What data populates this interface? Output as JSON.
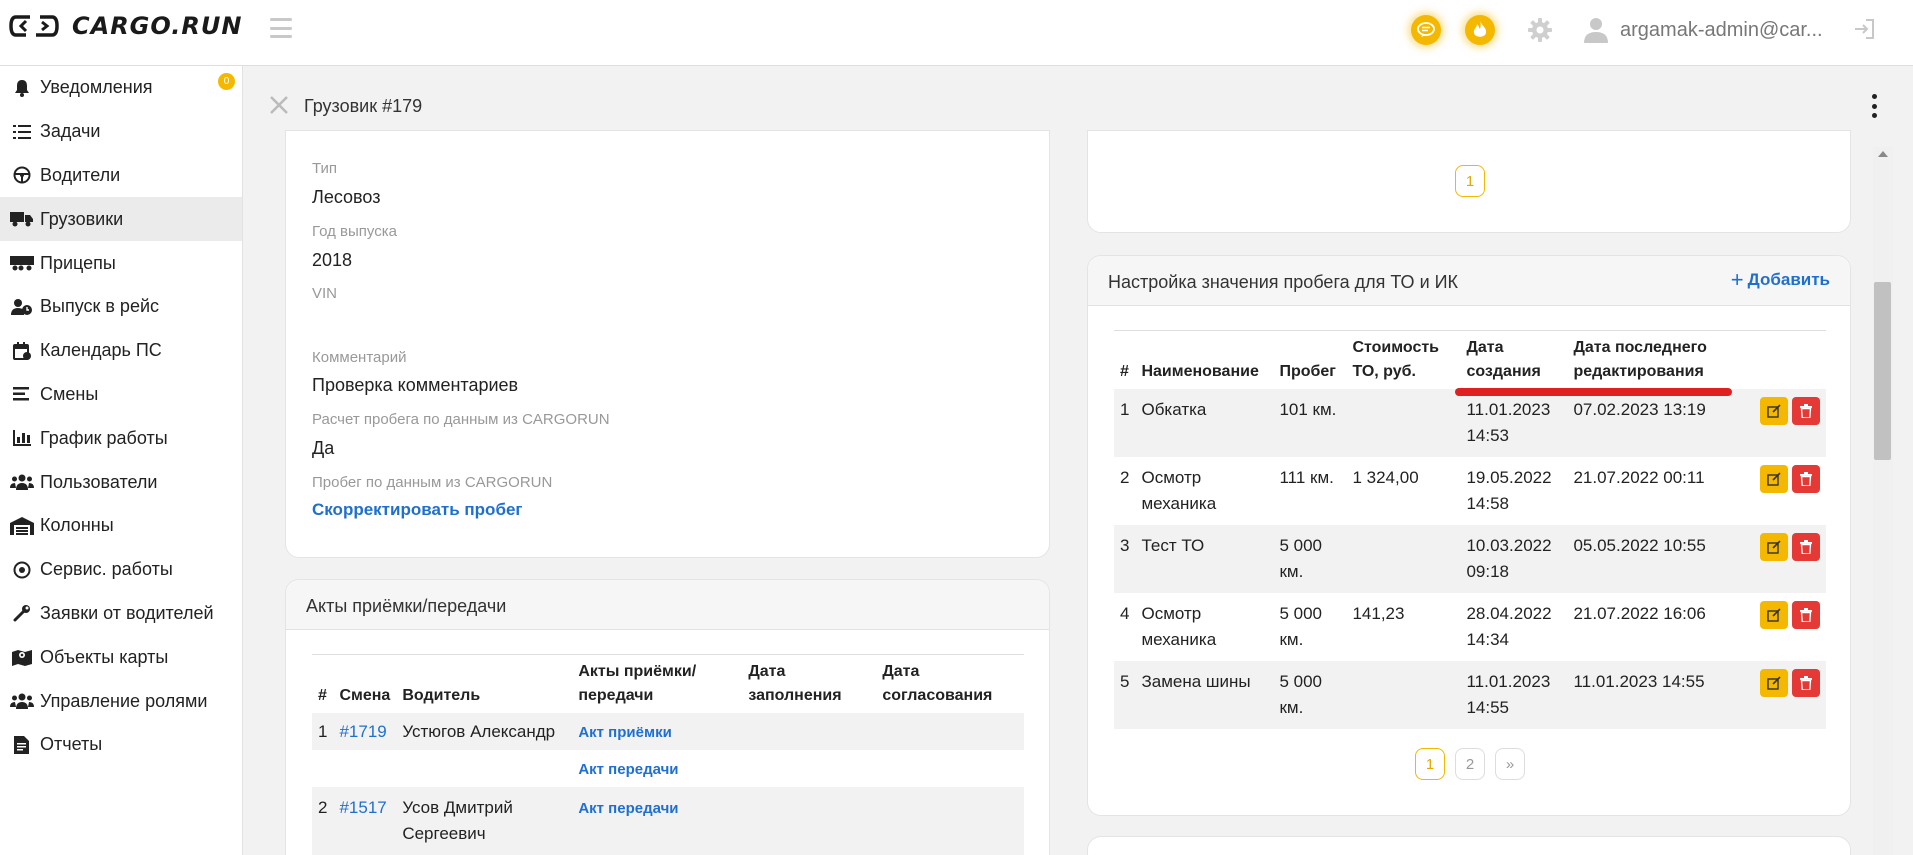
{
  "brand": {
    "name": "CARGO.RUN"
  },
  "header": {
    "user_email": "argamak-admin@car...",
    "accent_color": "#f5b800"
  },
  "sidebar": {
    "items": [
      {
        "label": "Уведомления",
        "icon": "bell-icon",
        "badge": "0"
      },
      {
        "label": "Задачи",
        "icon": "task-list-icon"
      },
      {
        "label": "Водители",
        "icon": "steering-wheel-icon"
      },
      {
        "label": "Грузовики",
        "icon": "truck-icon",
        "active": true
      },
      {
        "label": "Прицепы",
        "icon": "trailer-icon"
      },
      {
        "label": "Выпуск в рейс",
        "icon": "user-clock-icon"
      },
      {
        "label": "Календарь ПС",
        "icon": "calendar-icon"
      },
      {
        "label": "Смены",
        "icon": "shifts-icon"
      },
      {
        "label": "График работы",
        "icon": "bar-chart-icon"
      },
      {
        "label": "Пользователи",
        "icon": "users-icon"
      },
      {
        "label": "Колонны",
        "icon": "warehouse-icon"
      },
      {
        "label": "Сервис. работы",
        "icon": "service-icon"
      },
      {
        "label": "Заявки от водителей",
        "icon": "wrench-icon"
      },
      {
        "label": "Объекты карты",
        "icon": "map-icon"
      },
      {
        "label": "Управление ролями",
        "icon": "roles-icon"
      },
      {
        "label": "Отчеты",
        "icon": "report-icon"
      }
    ]
  },
  "page": {
    "title": "Грузовик #179"
  },
  "details": {
    "type_label": "Тип",
    "type_value": "Лесовоз",
    "year_label": "Год выпуска",
    "year_value": "2018",
    "vin_label": "VIN",
    "vin_value": "",
    "comment_label": "Комментарий",
    "comment_value": "Проверка комментариев",
    "mileage_calc_label": "Расчет пробега по данным из CARGORUN",
    "mileage_calc_value": "Да",
    "mileage_label": "Пробег по данным из CARGORUN",
    "mileage_link": "Скорректировать пробег"
  },
  "acts": {
    "title": "Акты приёмки/передачи",
    "columns": [
      "#",
      "Смена",
      "Водитель",
      "Акты приёмки/ передачи",
      "Дата заполнения",
      "Дата согласования"
    ],
    "rows": [
      {
        "num": "1",
        "shift": "#1719",
        "driver": "Устюгов Александр",
        "acts": [
          "Акт приёмки",
          "Акт передачи"
        ],
        "filled": "",
        "approved": ""
      },
      {
        "num": "2",
        "shift": "#1517",
        "driver": "Усов Дмитрий Сергеевич",
        "acts": [
          "Акт передачи"
        ],
        "filled": "",
        "approved": ""
      }
    ]
  },
  "top_right_pager": {
    "pages": [
      "1"
    ],
    "active": "1"
  },
  "mileage_settings": {
    "title": "Настройка значения пробега для ТО и ИК",
    "add_label": "Добавить",
    "columns": [
      "#",
      "Наименование",
      "Пробег",
      "Стоимость ТО, руб.",
      "Дата создания",
      "Дата последнего редактирования"
    ],
    "rows": [
      {
        "num": "1",
        "name": "Обкатка",
        "mileage": "101 км.",
        "cost": "",
        "created": "11.01.2023 14:53",
        "edited": "07.02.2023 13:19"
      },
      {
        "num": "2",
        "name": "Осмотр механика",
        "mileage": "111 км.",
        "cost": "1 324,00",
        "created": "19.05.2022 14:58",
        "edited": "21.07.2022 00:11"
      },
      {
        "num": "3",
        "name": "Тест ТО",
        "mileage": "5 000 км.",
        "cost": "",
        "created": "10.03.2022 09:18",
        "edited": "05.05.2022 10:55"
      },
      {
        "num": "4",
        "name": "Осмотр механика",
        "mileage": "5 000 км.",
        "cost": "141,23",
        "created": "28.04.2022 14:34",
        "edited": "21.07.2022 16:06"
      },
      {
        "num": "5",
        "name": "Замена шины",
        "mileage": "5 000 км.",
        "cost": "",
        "created": "11.01.2023 14:55",
        "edited": "11.01.2023 14:55"
      }
    ],
    "pager": {
      "pages": [
        "1",
        "2",
        "»"
      ],
      "active": "1"
    }
  }
}
